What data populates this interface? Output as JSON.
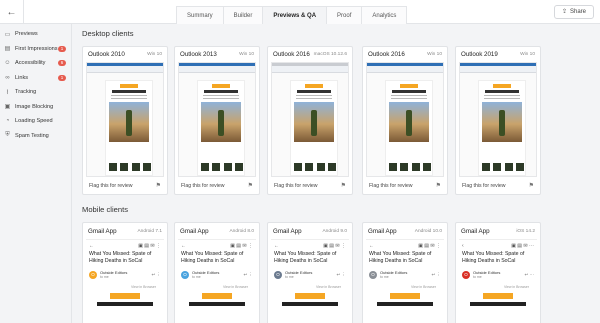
{
  "tabs": [
    "Summary",
    "Builder",
    "Previews & QA",
    "Proof",
    "Analytics"
  ],
  "active_tab": "Previews & QA",
  "share_label": "Share",
  "sidebar": {
    "items": [
      {
        "label": "Previews",
        "icon": "monitor-icon",
        "badge": ""
      },
      {
        "label": "First Impressions",
        "icon": "inbox-icon",
        "badge": "1"
      },
      {
        "label": "Accessibility",
        "icon": "accessibility-icon",
        "badge": "6"
      },
      {
        "label": "Links",
        "icon": "link-icon",
        "badge": "1"
      },
      {
        "label": "Tracking",
        "icon": "chart-icon",
        "badge": ""
      },
      {
        "label": "Image Blocking",
        "icon": "image-icon",
        "badge": ""
      },
      {
        "label": "Loading Speed",
        "icon": "speed-icon",
        "badge": ""
      },
      {
        "label": "Spam Testing",
        "icon": "shield-icon",
        "badge": ""
      }
    ]
  },
  "desktop": {
    "title": "Desktop clients",
    "flag_label": "Flag this for review",
    "clients": [
      {
        "name": "Outlook 2010",
        "os": "Win 10"
      },
      {
        "name": "Outlook 2013",
        "os": "Win 10"
      },
      {
        "name": "Outlook 2016",
        "os": "macOS 10.12.6"
      },
      {
        "name": "Outlook 2016",
        "os": "Win 10"
      },
      {
        "name": "Outlook 2019",
        "os": "Win 10"
      }
    ]
  },
  "mobile": {
    "title": "Mobile clients",
    "subject": "What You Missed: Spate of Hiking Deaths in SoCal",
    "inbox_tag": "Inbox",
    "sender": "Outside Editors",
    "to_me": "to me",
    "view_in_browser": "View in Browser",
    "clients": [
      {
        "name": "Gmail App",
        "os": "Android 7.1",
        "avatar_color": "#f5a623"
      },
      {
        "name": "Gmail App",
        "os": "Android 8.0",
        "avatar_color": "#4aa3df"
      },
      {
        "name": "Gmail App",
        "os": "Android 9.0",
        "avatar_color": "#6b7a8f"
      },
      {
        "name": "Gmail App",
        "os": "Android 10.0",
        "avatar_color": "#8a8f96"
      },
      {
        "name": "Gmail App",
        "os": "iOS 14.2",
        "avatar_color": "#d93025"
      }
    ]
  }
}
